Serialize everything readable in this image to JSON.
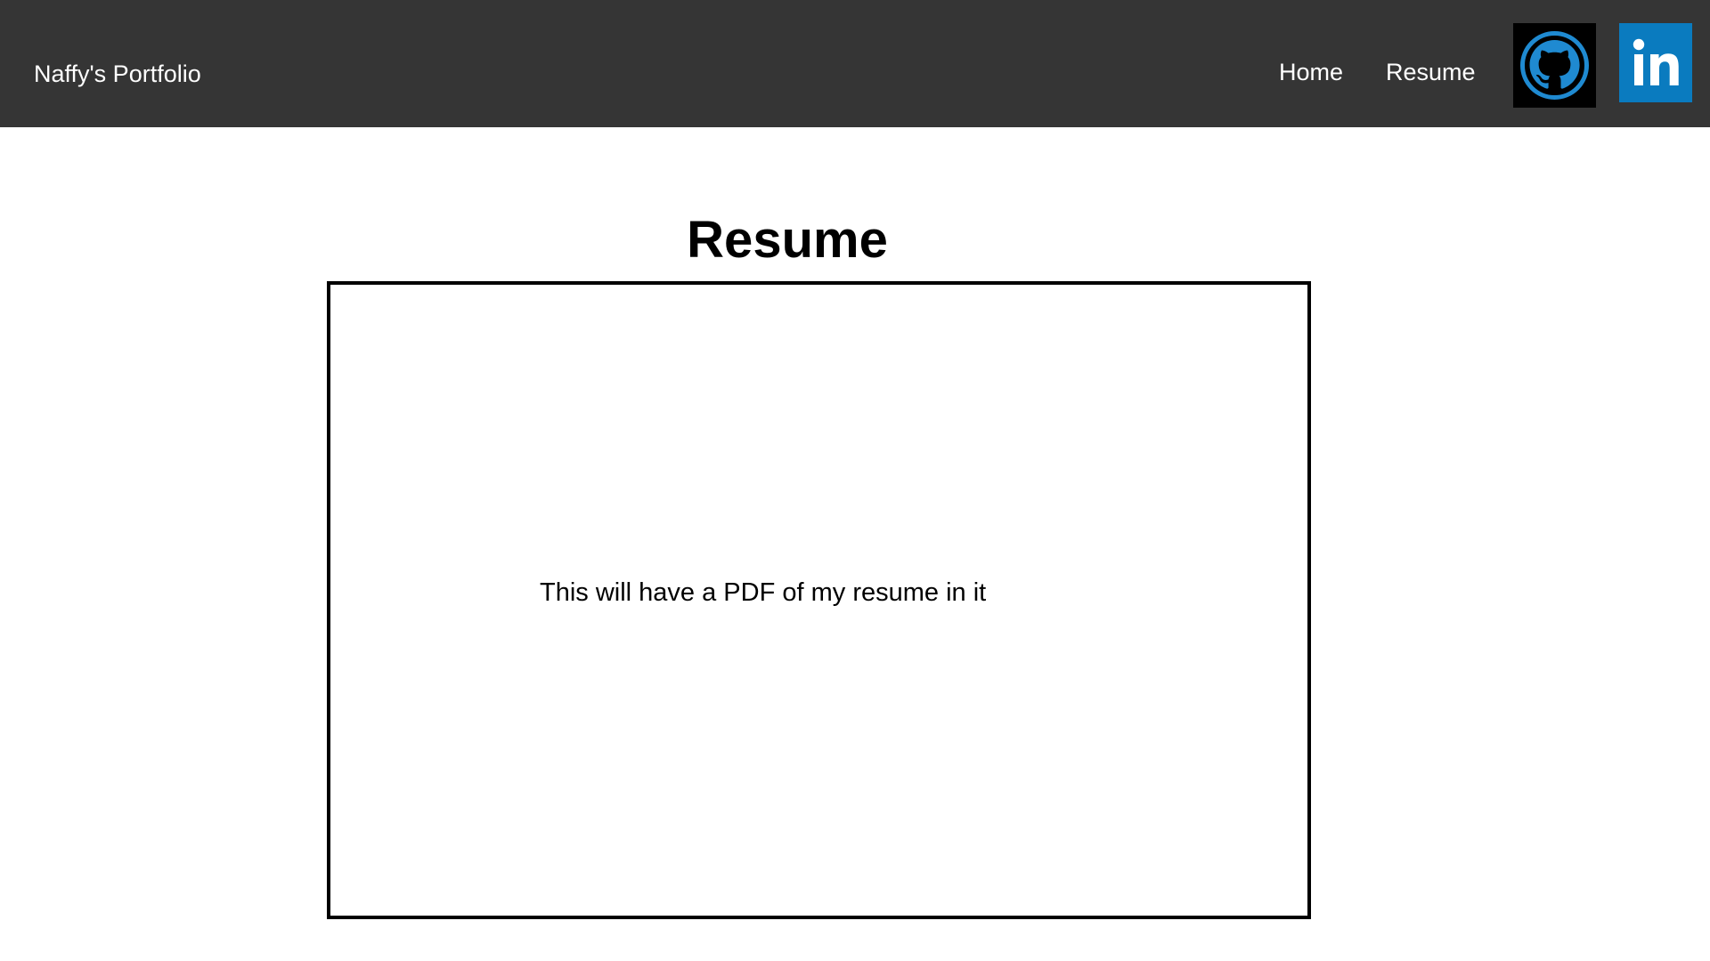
{
  "navbar": {
    "brand": "Naffy's Portfolio",
    "links": [
      {
        "label": "Home"
      },
      {
        "label": "Resume"
      }
    ],
    "social": [
      {
        "icon": "github-icon",
        "color": "#000000",
        "accent": "#1f8ad1"
      },
      {
        "icon": "linkedin-icon",
        "color": "#0a7bbf",
        "text": "in"
      }
    ],
    "background": "#353535"
  },
  "main": {
    "title": "Resume",
    "placeholder_text": "This will have a PDF of my resume in it"
  }
}
